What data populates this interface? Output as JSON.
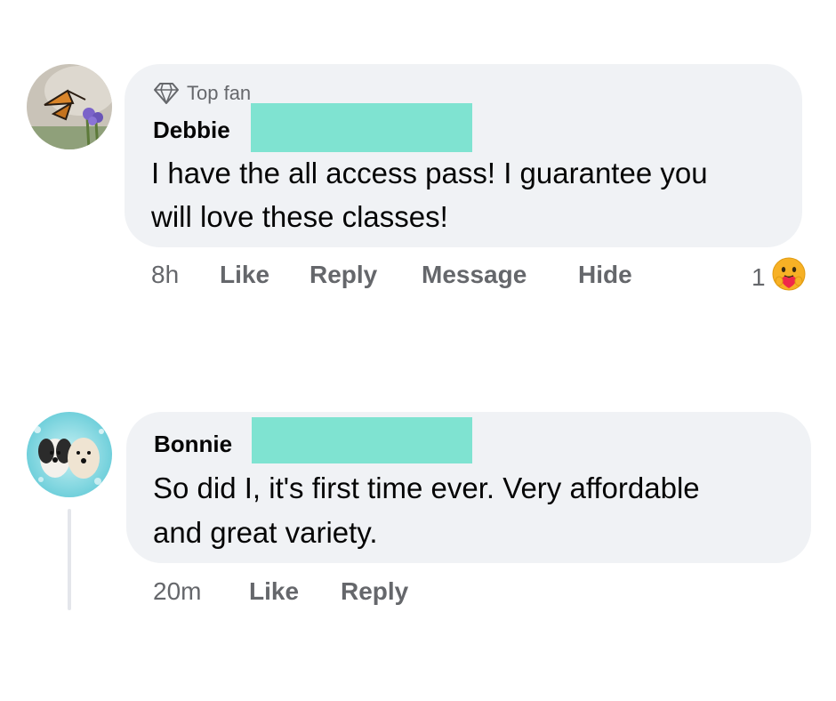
{
  "comments": [
    {
      "badge": "Top fan",
      "author": "Debbie",
      "text_lines": [
        "I have the all access pass!  I guarantee you",
        "will love these classes!"
      ],
      "time": "8h",
      "actions": {
        "like": "Like",
        "reply": "Reply",
        "message": "Message",
        "hide": "Hide"
      },
      "reaction_count": "1",
      "reaction_icon": "care-reaction-icon"
    },
    {
      "author": "Bonnie",
      "text_lines": [
        "So did I, it's first time ever. Very affordable",
        "and great variety."
      ],
      "time": "20m",
      "actions": {
        "like": "Like",
        "reply": "Reply"
      }
    }
  ],
  "colors": {
    "bubble": "#f0f2f5",
    "meta_text": "#65676b",
    "redaction": "#7fe3d1",
    "thread_line": "#e4e6eb"
  }
}
